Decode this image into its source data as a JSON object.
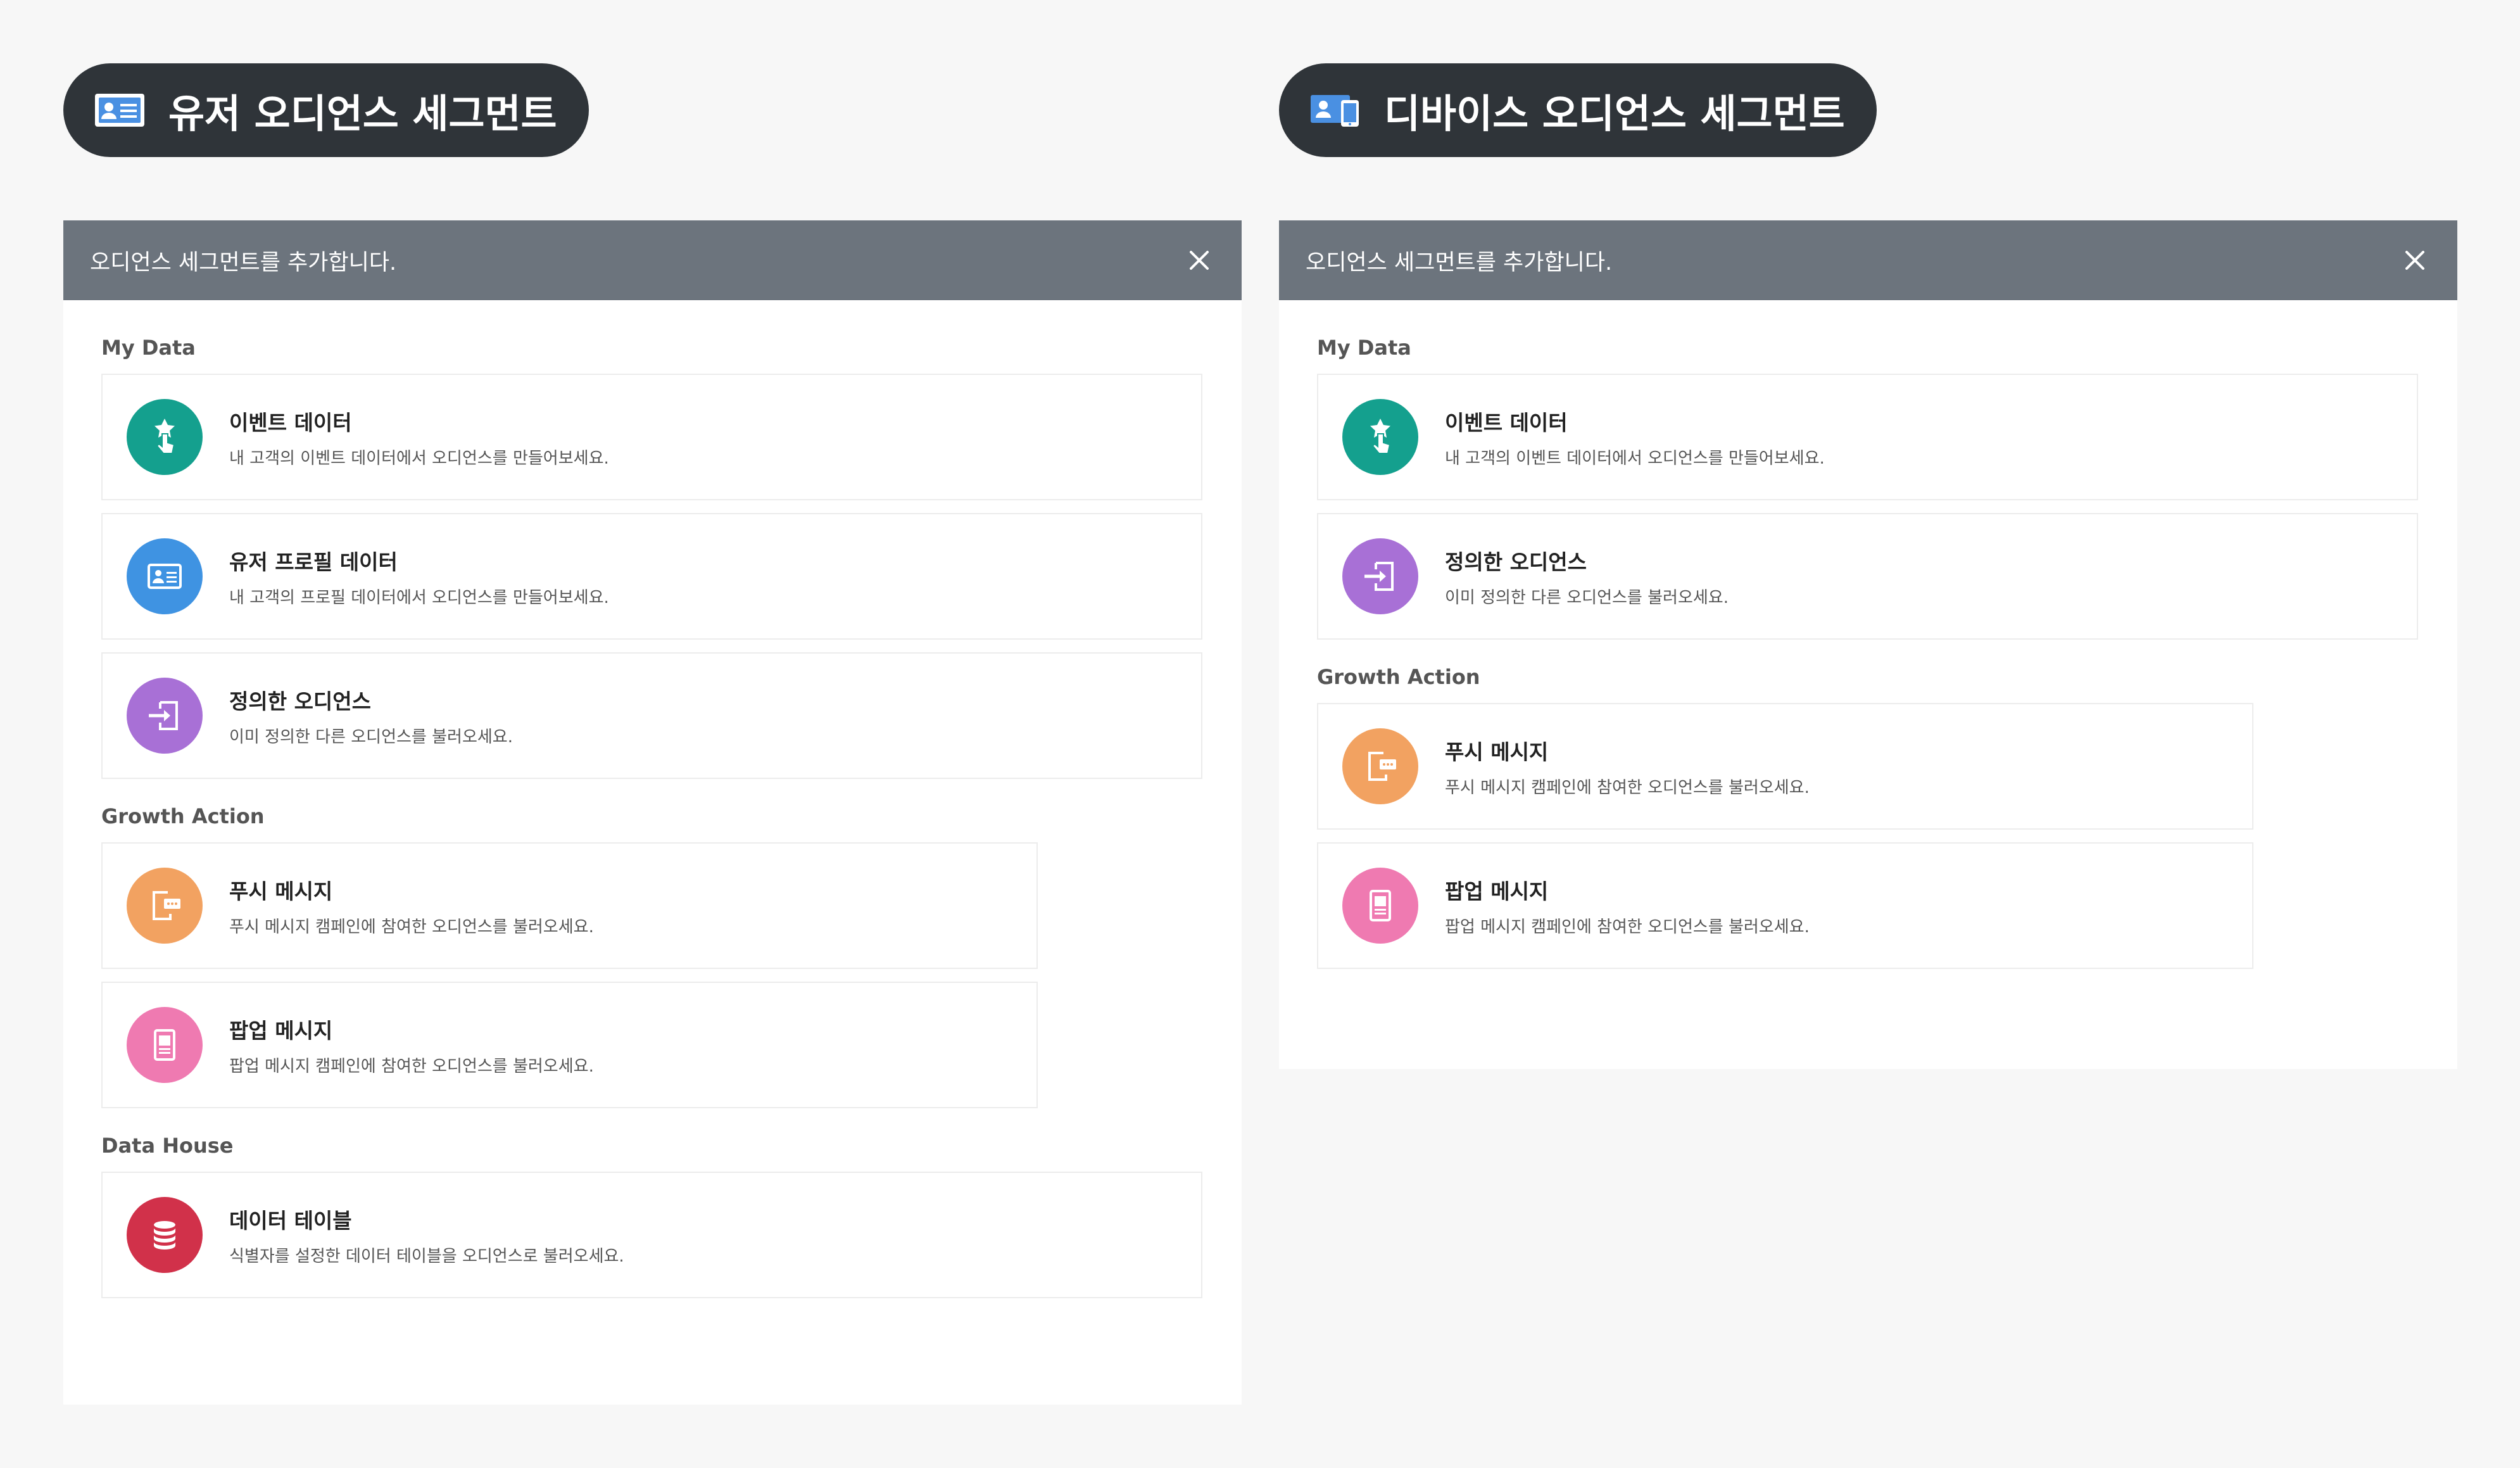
{
  "left": {
    "pill_title": "유저 오디언스 세그먼트",
    "header_text": "오디언스 세그먼트를 추가합니다.",
    "sections": [
      {
        "title": "My Data",
        "cards": [
          {
            "title": "이벤트 데이터",
            "desc": "내 고객의 이벤트 데이터에서 오디언스를 만들어보세요.",
            "icon": "tap-star-icon"
          },
          {
            "title": "유저 프로필 데이터",
            "desc": "내 고객의 프로필 데이터에서 오디언스를 만들어보세요.",
            "icon": "id-card-icon"
          },
          {
            "title": "정의한 오디언스",
            "desc": "이미 정의한 다른 오디언스를 불러오세요.",
            "icon": "import-icon"
          }
        ]
      },
      {
        "title": "Growth Action",
        "cards": [
          {
            "title": "푸시 메시지",
            "desc": "푸시 메시지 캠페인에 참여한 오디언스를 불러오세요.",
            "icon": "push-message-icon"
          },
          {
            "title": "팝업 메시지",
            "desc": "팝업 메시지 캠페인에 참여한 오디언스를 불러오세요.",
            "icon": "popup-message-icon"
          }
        ]
      },
      {
        "title": "Data House",
        "cards": [
          {
            "title": "데이터 테이블",
            "desc": "식별자를 설정한 데이터 테이블을 오디언스로 불러오세요.",
            "icon": "database-icon"
          }
        ]
      }
    ]
  },
  "right": {
    "pill_title": "디바이스 오디언스 세그먼트",
    "header_text": "오디언스 세그먼트를 추가합니다.",
    "sections": [
      {
        "title": "My Data",
        "cards": [
          {
            "title": "이벤트 데이터",
            "desc": "내 고객의 이벤트 데이터에서 오디언스를 만들어보세요.",
            "icon": "tap-star-icon"
          },
          {
            "title": "정의한 오디언스",
            "desc": "이미 정의한 다른 오디언스를 불러오세요.",
            "icon": "import-icon"
          }
        ]
      },
      {
        "title": "Growth Action",
        "cards": [
          {
            "title": "푸시 메시지",
            "desc": "푸시 메시지 캠페인에 참여한 오디언스를 불러오세요.",
            "icon": "push-message-icon"
          },
          {
            "title": "팝업 메시지",
            "desc": "팝업 메시지 캠페인에 참여한 오디언스를 불러오세요.",
            "icon": "popup-message-icon"
          }
        ]
      }
    ]
  }
}
